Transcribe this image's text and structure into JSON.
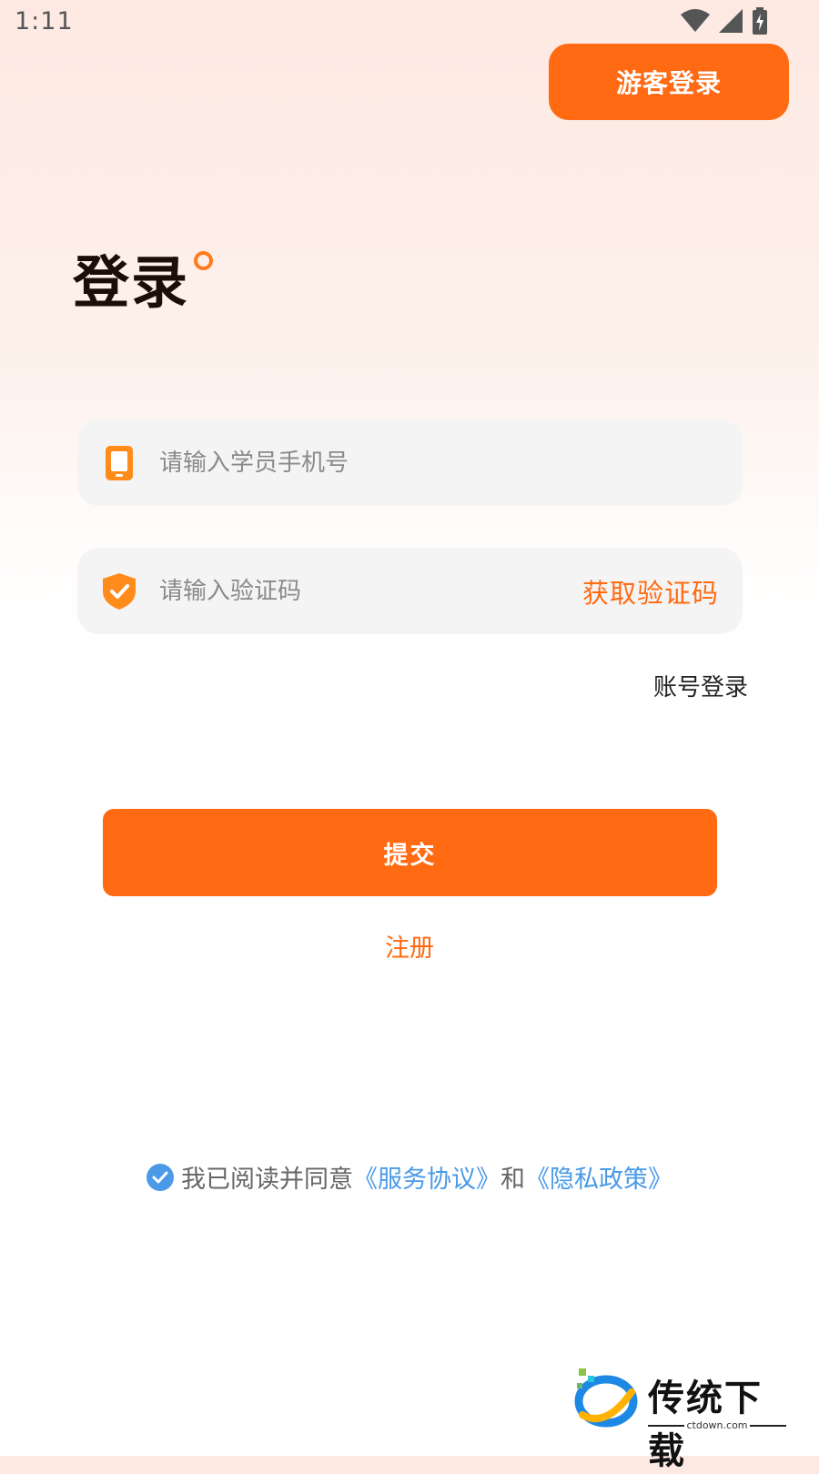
{
  "status_bar": {
    "time": "1:11"
  },
  "header": {
    "guest_login_label": "游客登录"
  },
  "page": {
    "title": "登录"
  },
  "form": {
    "phone_placeholder": "请输入学员手机号",
    "phone_value": "",
    "code_placeholder": "请输入验证码",
    "code_value": "",
    "get_code_label": "获取验证码",
    "account_login_label": "账号登录",
    "submit_label": "提交",
    "register_label": "注册"
  },
  "agreement": {
    "prefix": "我已阅读并同意",
    "service_link": "《服务协议》",
    "and": "和",
    "privacy_link": "《隐私政策》",
    "checked": true
  },
  "watermark": {
    "brand": "传统下载",
    "domain": "ctdown.com"
  },
  "colors": {
    "accent": "#ff6a12",
    "link": "#4a9ae8",
    "title": "#1a0f08"
  },
  "icons": {
    "phone": "phone-icon",
    "shield": "shield-check-icon",
    "check": "check-circle-icon",
    "wifi": "wifi-icon",
    "signal": "signal-icon",
    "battery": "battery-charging-icon"
  }
}
